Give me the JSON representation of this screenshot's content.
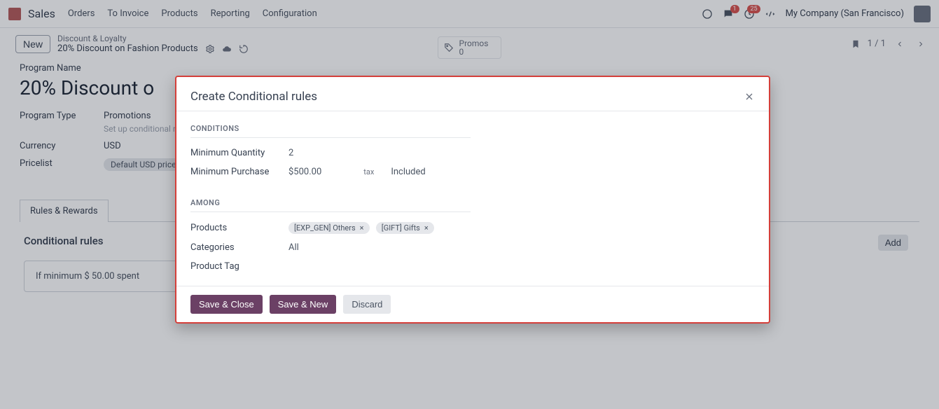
{
  "navbar": {
    "brand": "Sales",
    "menu": [
      "Orders",
      "To Invoice",
      "Products",
      "Reporting",
      "Configuration"
    ],
    "badge_chat": "1",
    "badge_activity": "25",
    "company": "My Company (San Francisco)"
  },
  "subbar": {
    "new_label": "New",
    "breadcrumb_parent": "Discount & Loyalty",
    "breadcrumb_current": "20% Discount on Fashion Products",
    "stat_label": "Promos",
    "stat_value": "0",
    "pager": "1 / 1"
  },
  "page": {
    "program_name_label": "Program Name",
    "program_name": "20% Discount o",
    "program_type_label": "Program Type",
    "program_type": "Promotions",
    "program_type_help": "Set up conditional rule",
    "currency_label": "Currency",
    "currency": "USD",
    "pricelist_label": "Pricelist",
    "pricelist": "Default USD pricelist (U",
    "tab_label": "Rules & Rewards",
    "cond_rules_title": "Conditional rules",
    "add_label": "Add",
    "rule_text": "If minimum $ 50.00 spent"
  },
  "modal": {
    "title": "Create Conditional rules",
    "sec_conditions": "CONDITIONS",
    "min_qty_label": "Minimum Quantity",
    "min_qty": "2",
    "min_purchase_label": "Minimum Purchase",
    "min_purchase": "$500.00",
    "tax_label": "tax",
    "tax_value": "Included",
    "sec_among": "AMONG",
    "products_label": "Products",
    "product_tags": [
      "[EXP_GEN] Others",
      "[GIFT] Gifts"
    ],
    "categories_label": "Categories",
    "categories": "All",
    "product_tag_label": "Product Tag",
    "save_close": "Save & Close",
    "save_new": "Save & New",
    "discard": "Discard"
  }
}
